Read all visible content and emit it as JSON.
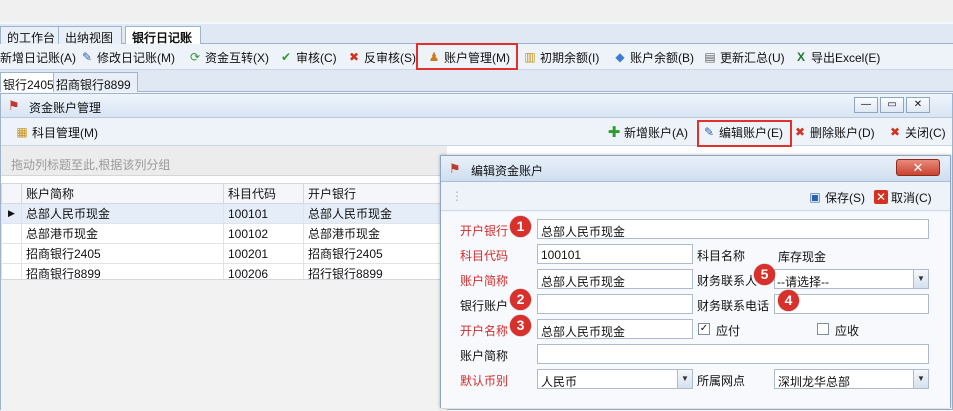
{
  "top_tabs": [
    "的工作台",
    "出纳视图",
    "银行日记账"
  ],
  "toolbar": {
    "new_entry": "新增日记账(A)",
    "edit_entry": "修改日记账(M)",
    "transfer": "资金互转(X)",
    "audit": "审核(C)",
    "unaudit": "反审核(S)",
    "account_mgmt": "账户管理(M)",
    "opening_balance": "初期余额(I)",
    "account_balance": "账户余额(B)",
    "update_summary": "更新汇总(U)",
    "export_excel": "导出Excel(E)"
  },
  "bank_tabs": [
    "银行2405",
    "招商银行8899"
  ],
  "mdi": {
    "title": "资金账户管理",
    "subject_mgmt": "科目管理(M)",
    "add_account": "新增账户(A)",
    "edit_account": "编辑账户(E)",
    "delete_account": "删除账户(D)",
    "close": "关闭(C)",
    "group_hint": "拖动列标题至此,根据该列分组"
  },
  "grid": {
    "columns": [
      "账户简称",
      "科目代码",
      "开户银行"
    ],
    "rows": [
      [
        "总部人民币现金",
        "100101",
        "总部人民币现金"
      ],
      [
        "总部港币现金",
        "100102",
        "总部港币现金"
      ],
      [
        "招商银行2405",
        "100201",
        "招商银行2405"
      ],
      [
        "招商银行8899",
        "100206",
        "招行银行8899"
      ]
    ]
  },
  "dialog": {
    "title": "编辑资金账户",
    "save": "保存(S)",
    "cancel": "取消(C)",
    "close_glyph": "✕",
    "labels": {
      "bank": "开户银行",
      "subject_code": "科目代码",
      "subject_name": "科目名称",
      "short_name": "账户简称",
      "finance_contact": "财务联系人",
      "bank_account": "银行账户",
      "finance_phone": "财务联系电话",
      "account_name": "开户名称",
      "payable": "应付",
      "receivable": "应收",
      "short_name2": "账户简称",
      "currency": "默认币别",
      "branch": "所属网点"
    },
    "values": {
      "bank": "总部人民币现金",
      "subject_code": "100101",
      "subject_name": "库存现金",
      "short_name": "总部人民币现金",
      "finance_contact": "--请选择--",
      "bank_account": "",
      "finance_phone": "",
      "account_name": "总部人民币现金",
      "payable_checked": true,
      "receivable_checked": false,
      "short_name2": "",
      "currency": "人民币",
      "branch": "深圳龙华总部"
    }
  },
  "badges": [
    "1",
    "2",
    "3",
    "4",
    "5"
  ],
  "colors": {
    "required_label": "#d22d2d",
    "highlight": "#e2312d",
    "badge": "#d9302b"
  }
}
